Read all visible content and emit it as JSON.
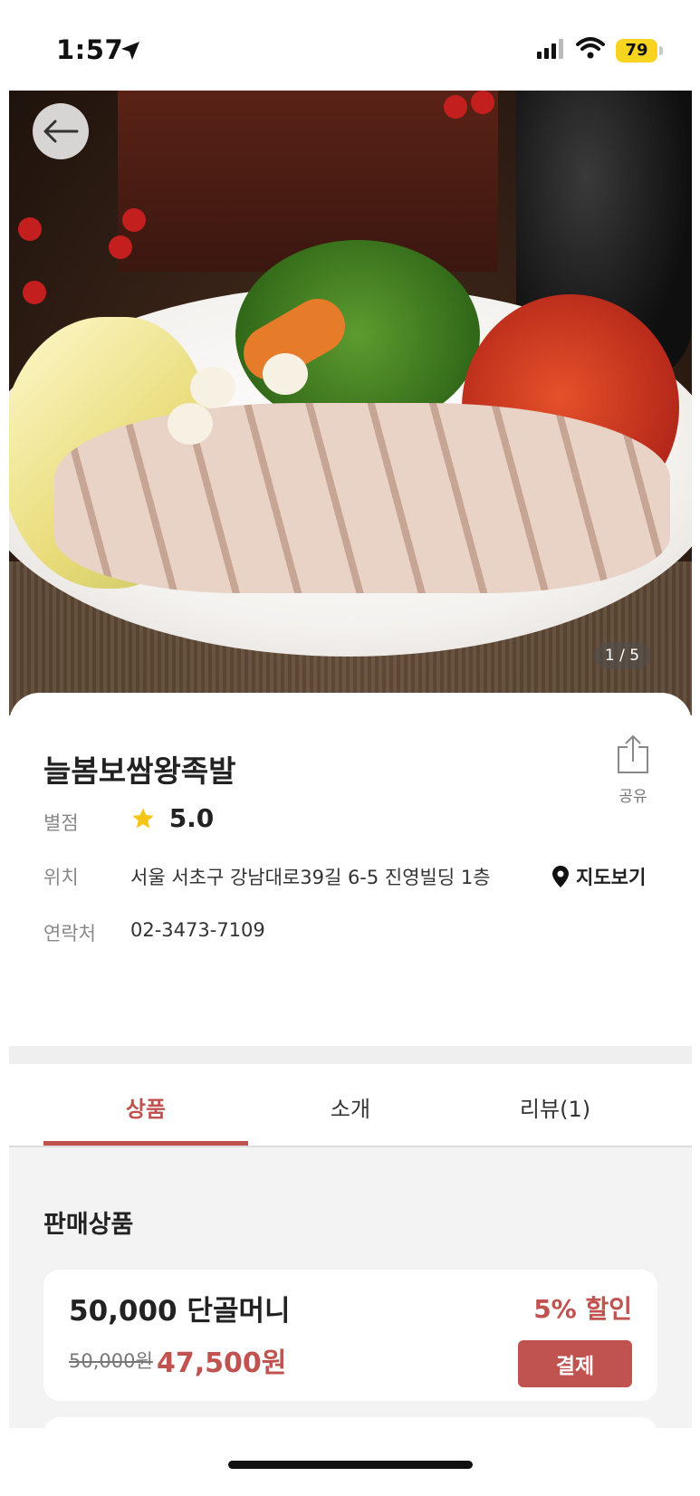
{
  "status_bar": {
    "time": "1:57",
    "battery": "79"
  },
  "hero": {
    "pager": "1 / 5"
  },
  "store": {
    "name": "늘봄보쌈왕족발",
    "share_label": "공유",
    "rating_label": "별점",
    "rating_value": "5.0",
    "location_label": "위치",
    "address": "서울 서초구 강남대로39길 6-5 진영빌딩 1층",
    "map_label": "지도보기",
    "contact_label": "연락처",
    "phone": "02-3473-7109"
  },
  "tabs": [
    {
      "label": "상품",
      "active": true
    },
    {
      "label": "소개",
      "active": false
    },
    {
      "label": "리뷰(1)",
      "active": false
    }
  ],
  "products": {
    "heading": "판매상품",
    "items": [
      {
        "name": "50,000 단골머니",
        "original_price": "50,000원",
        "price": "47,500원",
        "discount": "5% 할인",
        "pay_label": "결제"
      }
    ]
  },
  "colors": {
    "accent": "#c0524f",
    "star": "#f5c518",
    "battery": "#f7d41f"
  }
}
